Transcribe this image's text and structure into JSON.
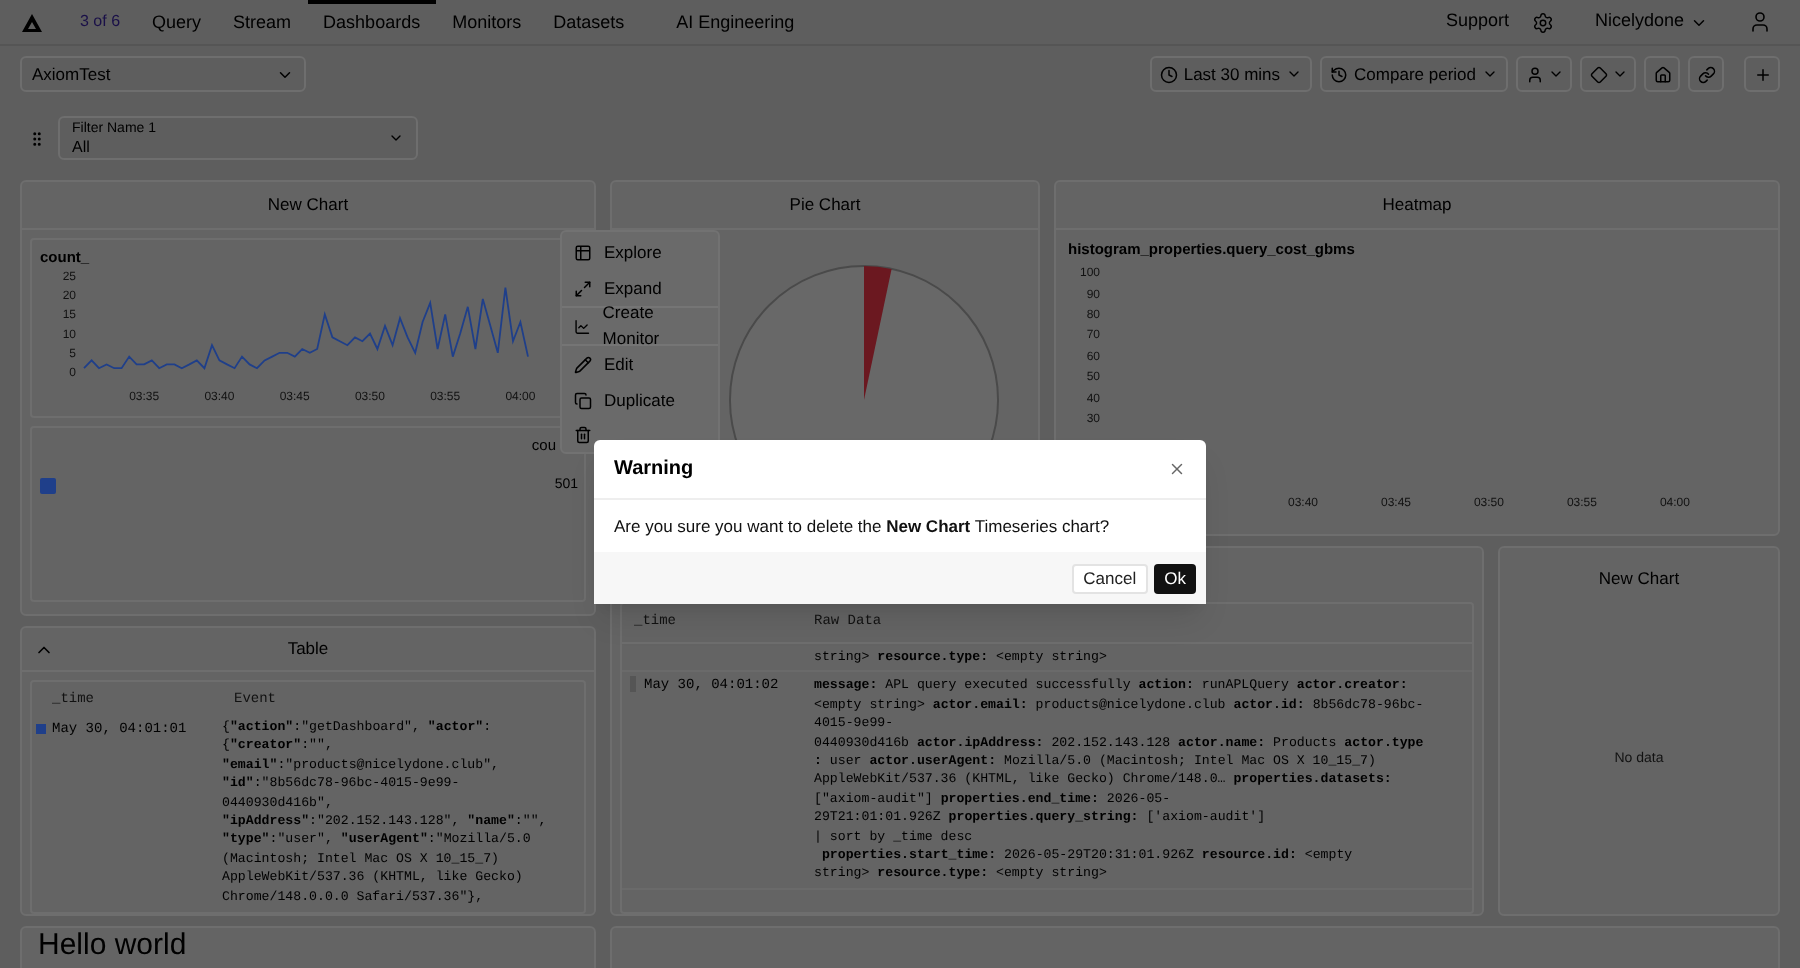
{
  "nav": {
    "badge": "3 of 6",
    "items": [
      {
        "label": "Query",
        "selected": false
      },
      {
        "label": "Stream",
        "selected": false
      },
      {
        "label": "Dashboards",
        "selected": true
      },
      {
        "label": "Monitors",
        "selected": false
      },
      {
        "label": "Datasets",
        "selected": false
      },
      {
        "label": "AI Engineering",
        "selected": false
      }
    ],
    "support": "Support",
    "user": "Nicelydone"
  },
  "toolbar": {
    "dashboard": "AxiomTest",
    "time_range": "Last 30 mins",
    "compare": "Compare period"
  },
  "filter": {
    "label": "Filter Name 1",
    "value": "All"
  },
  "line_chart_panel": {
    "title": "New Chart",
    "legend_header": "cou",
    "legend_value": "501",
    "chart_data": {
      "type": "line",
      "categories": [
        null,
        null,
        null,
        null,
        null,
        null,
        null,
        null,
        "03:35",
        null,
        null,
        null,
        null,
        null,
        null,
        null,
        null,
        null,
        "03:40",
        null,
        null,
        null,
        null,
        null,
        null,
        null,
        null,
        null,
        "03:45",
        null,
        null,
        null,
        null,
        null,
        null,
        null,
        null,
        null,
        "03:50",
        null,
        null,
        null,
        null,
        null,
        null,
        null,
        null,
        null,
        "03:55",
        null,
        null,
        null,
        null,
        null,
        null,
        null,
        null,
        null,
        "04:00",
        null
      ],
      "series": [
        {
          "name": "count_",
          "color": "#1f3f8a",
          "values": [
            1,
            3,
            1,
            2,
            1,
            1,
            4,
            2,
            2,
            3,
            1,
            2,
            2,
            1,
            2,
            3,
            1,
            7,
            3,
            2,
            1,
            4,
            2,
            1,
            3,
            4,
            5,
            5,
            4,
            6,
            5,
            6,
            15,
            9,
            8,
            7,
            9,
            8,
            10,
            6,
            12,
            7,
            14,
            9,
            5,
            13,
            18,
            6,
            15,
            4,
            10,
            17,
            6,
            19,
            12,
            5,
            22,
            8,
            13,
            4
          ]
        }
      ],
      "ylim": [
        0,
        25
      ],
      "yticks": [
        0,
        5,
        10,
        15,
        20,
        25
      ]
    }
  },
  "context_menu": {
    "groups": [
      [
        {
          "label": "Explore"
        },
        {
          "label": "Expand"
        }
      ],
      [
        {
          "label": "Create Monitor"
        }
      ],
      [
        {
          "label": "Edit"
        },
        {
          "label": "Duplicate"
        }
      ]
    ]
  },
  "pie_panel": {
    "title": "Pie Chart"
  },
  "heatmap_panel": {
    "title": "Heatmap",
    "series_label": "histogram_properties.query_cost_gbms",
    "yticks": [
      "100",
      "90",
      "80",
      "70",
      "60",
      "50",
      "40",
      "30"
    ],
    "xticks": [
      "03:40",
      "03:45",
      "03:50",
      "03:55",
      "04:00"
    ]
  },
  "table_panel": {
    "title": "Table",
    "columns": [
      "_time",
      "Event"
    ],
    "rows": [
      {
        "time": "May 30, 04:01:01",
        "event": "{**\"action\"**:\"getDashboard\", **\"actor\"**:\n{**\"creator\"**:\"\",\n**\"email\"**:\"products@nicelydone.club\",\n**\"id\"**:\"8b56dc78-96bc-4015-9e99-\n0440930d416b\",\n**\"ipAddress\"**:\"202.152.143.128\", **\"name\"**:\"\",\n**\"type\"**:\"user\", **\"userAgent\"**:\"Mozilla/5.0\n(Macintosh; Intel Mac OS X 10_15_7)\nAppleWebKit/537.36 (KHTML, like Gecko)\nChrome/148.0.0.0 Safari/537.36\"},"
      }
    ]
  },
  "log_panel": {
    "columns": [
      "_time",
      "Raw Data"
    ],
    "rows": [
      {
        "raw": "string> **resource.type:** <empty string>"
      },
      {
        "time": "May 30, 04:01:02",
        "raw": "**message:** APL query executed successfully **action:** runAPLQuery **actor.creator:**\n<empty string> **actor.email:** products@nicelydone.club **actor.id:** 8b56dc78-96bc-\n4015-9e99-\n0440930d416b **actor.ipAddress:** 202.152.143.128 **actor.name:** Products **actor.type**\n**:** user **actor.userAgent:** Mozilla/5.0 (Macintosh; Intel Mac OS X 10_15_7)\nAppleWebKit/537.36 (KHTML, like Gecko) Chrome/148.0… **properties.datasets:**\n[\"axiom-audit\"] **properties.end_time:** 2026-05-\n29T21:01:01.926Z **properties.query_string:** ['axiom-audit']\n| sort by _time desc\n **properties.start_time:** 2026-05-29T20:31:01.926Z **resource.id:** <empty\nstring> **resource.type:** <empty string>"
      }
    ]
  },
  "empty_panel": {
    "title": "New Chart",
    "message": "No data"
  },
  "text_panel": {
    "heading": "Hello world"
  },
  "dialog": {
    "title": "Warning",
    "message": "Are you sure you want to delete the **New Chart** Timeseries chart?",
    "buttons": [
      {
        "label": "Cancel",
        "kind": "secondary"
      },
      {
        "label": "Ok",
        "kind": "primary"
      }
    ]
  }
}
